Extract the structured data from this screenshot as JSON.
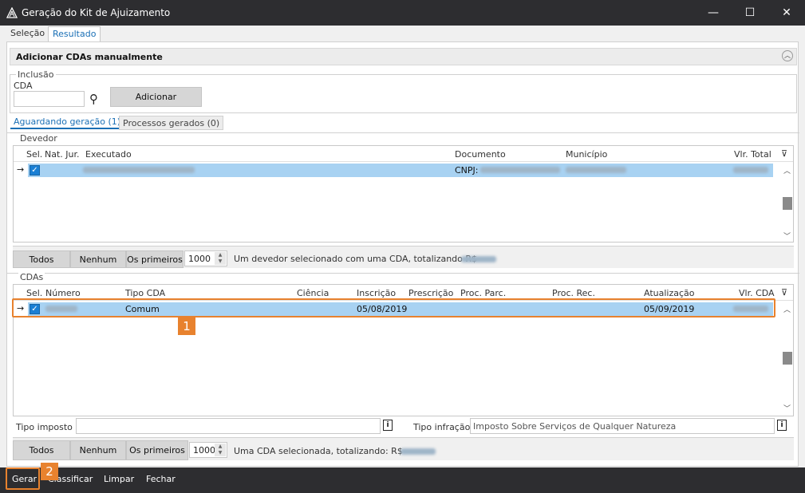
{
  "window": {
    "title": "Geração do Kit de Ajuizamento",
    "minimize": "—",
    "maximize": "☐",
    "close": "✕"
  },
  "tabs": [
    {
      "label": "Seleção"
    },
    {
      "label": "Resultado"
    }
  ],
  "section": {
    "title": "Adicionar CDAs manualmente",
    "collapse": "︿"
  },
  "inclusao": {
    "group_title": "Inclusão",
    "cda_label": "CDA",
    "cda_value": "",
    "add_button": "Adicionar",
    "search_icon": "⚲"
  },
  "subtabs": [
    {
      "label": "Aguardando geração (1)"
    },
    {
      "label": "Processos gerados (0)"
    }
  ],
  "devedor": {
    "group_title": "Devedor",
    "columns": [
      "Sel.",
      "Nat. Jur.",
      "Executado",
      "Documento",
      "Município",
      "Vlr. Total"
    ],
    "row": {
      "arrow": "→",
      "check": "✓",
      "documento_prefix": "CNPJ:"
    },
    "filter_icon": "⊽"
  },
  "devedor_toolbar": {
    "todos": "Todos",
    "nenhum": "Nenhum",
    "os_primeiros": "Os primeiros",
    "count": "1000",
    "summary": "Um devedor selecionado com uma CDA, totalizando R$"
  },
  "cdas": {
    "group_title": "CDAs",
    "columns": [
      "Sel.",
      "Número",
      "Tipo CDA",
      "Ciência",
      "Inscrição",
      "Prescrição",
      "Proc. Parc.",
      "Proc. Rec.",
      "Atualização",
      "Vlr. CDA"
    ],
    "row": {
      "arrow": "→",
      "check": "✓",
      "tipo": "Comum",
      "inscricao": "05/08/2019",
      "atualizacao": "05/09/2019"
    },
    "filter_icon": "⊽"
  },
  "tipos": {
    "tipo_imposto_label": "Tipo imposto",
    "tipo_imposto_value": "",
    "tipo_infracao_label": "Tipo infração",
    "tipo_infracao_value": "Imposto Sobre Serviços de Qualquer Natureza",
    "info_icon": "i"
  },
  "cdas_toolbar": {
    "todos": "Todos",
    "nenhum": "Nenhum",
    "os_primeiros": "Os primeiros",
    "count": "1000",
    "summary": "Uma CDA selecionada, totalizando: R$"
  },
  "scroll": {
    "up": "︿",
    "down": "﹀"
  },
  "badges": {
    "one": "1",
    "two": "2"
  },
  "bottom": {
    "gerar": "Gerar",
    "classificar": "Classificar",
    "limpar": "Limpar",
    "fechar": "Fechar"
  },
  "colors": {
    "accent": "#1a6fb5",
    "selection": "#a8d2f2",
    "highlight": "#e8822e",
    "chrome": "#2d2d30"
  }
}
